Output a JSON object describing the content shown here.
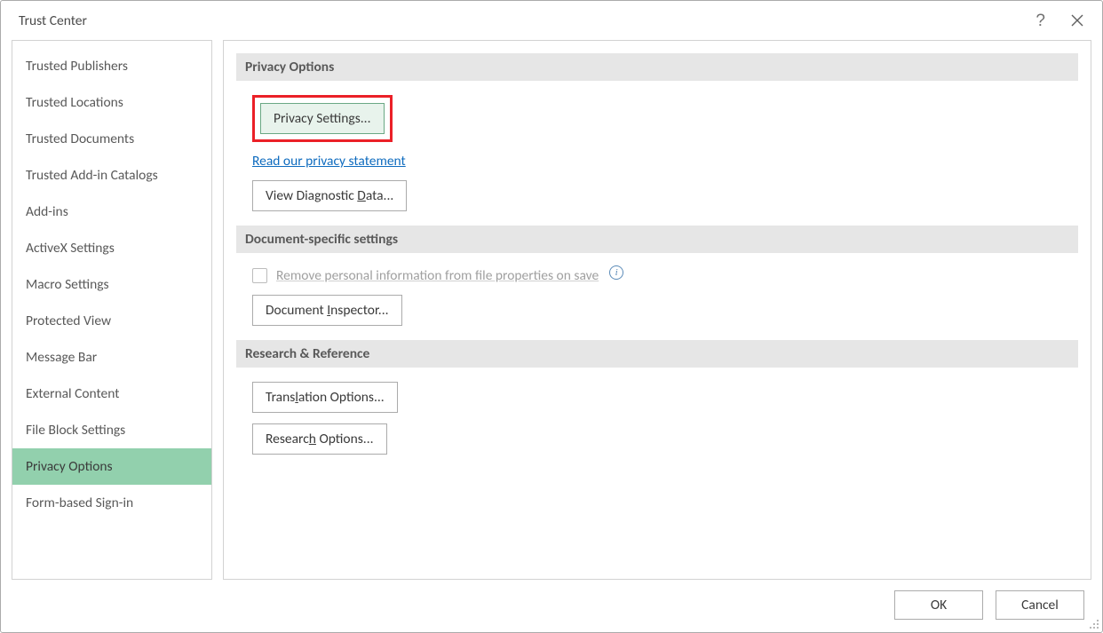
{
  "window": {
    "title": "Trust Center"
  },
  "sidebar": {
    "items": [
      {
        "label": "Trusted Publishers",
        "selected": false
      },
      {
        "label": "Trusted Locations",
        "selected": false
      },
      {
        "label": "Trusted Documents",
        "selected": false
      },
      {
        "label": "Trusted Add-in Catalogs",
        "selected": false
      },
      {
        "label": "Add-ins",
        "selected": false
      },
      {
        "label": "ActiveX Settings",
        "selected": false
      },
      {
        "label": "Macro Settings",
        "selected": false
      },
      {
        "label": "Protected View",
        "selected": false
      },
      {
        "label": "Message Bar",
        "selected": false
      },
      {
        "label": "External Content",
        "selected": false
      },
      {
        "label": "File Block Settings",
        "selected": false
      },
      {
        "label": "Privacy Options",
        "selected": true
      },
      {
        "label": "Form-based Sign-in",
        "selected": false
      }
    ]
  },
  "sections": {
    "privacy": {
      "header": "Privacy Options",
      "privacy_settings_btn": "Privacy Settings...",
      "privacy_statement_link": "Read our privacy statement",
      "view_diag_pre": "View Diagnostic ",
      "view_diag_u": "D",
      "view_diag_post": "ata..."
    },
    "docspecific": {
      "header": "Document-specific settings",
      "remove_pre": "",
      "remove_u": "R",
      "remove_post": "emove personal information from file properties on save",
      "doc_inspector_pre": "Document ",
      "doc_inspector_u": "I",
      "doc_inspector_post": "nspector..."
    },
    "research": {
      "header": "Research & Reference",
      "translation_pre": "Trans",
      "translation_u": "l",
      "translation_post": "ation Options...",
      "researchopt_pre": "Researc",
      "researchopt_u": "h",
      "researchopt_post": " Options..."
    }
  },
  "footer": {
    "ok": "OK",
    "cancel": "Cancel"
  }
}
